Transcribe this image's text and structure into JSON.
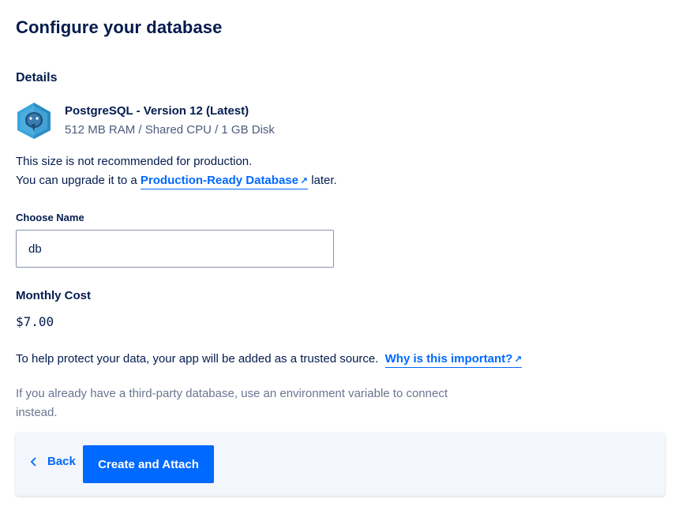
{
  "page": {
    "title": "Configure your database"
  },
  "details": {
    "section_title": "Details",
    "logo_icon": "postgresql-elephant-icon",
    "db_name": "PostgreSQL - Version 12 (Latest)",
    "db_specs": "512 MB RAM / Shared CPU / 1 GB Disk"
  },
  "warning": {
    "line1": "This size is not recommended for production.",
    "line2_prefix": "You can upgrade it to a",
    "link_text": "Production-Ready Database",
    "line2_suffix": "later."
  },
  "name_field": {
    "label": "Choose Name",
    "value": "db"
  },
  "cost": {
    "label": "Monthly Cost",
    "value": "$7.00"
  },
  "trust": {
    "text": "To help protect your data, your app will be added as a trusted source.",
    "link_text": "Why is this important?"
  },
  "note": {
    "text": "If you already have a third-party database, use an environment variable to connect instead."
  },
  "footer": {
    "back_label": "Back",
    "create_label": "Create and Attach"
  },
  "colors": {
    "accent": "#0069ff",
    "text": "#031b4e",
    "muted": "#6b7591",
    "footer_bg": "#f3f7fd"
  }
}
